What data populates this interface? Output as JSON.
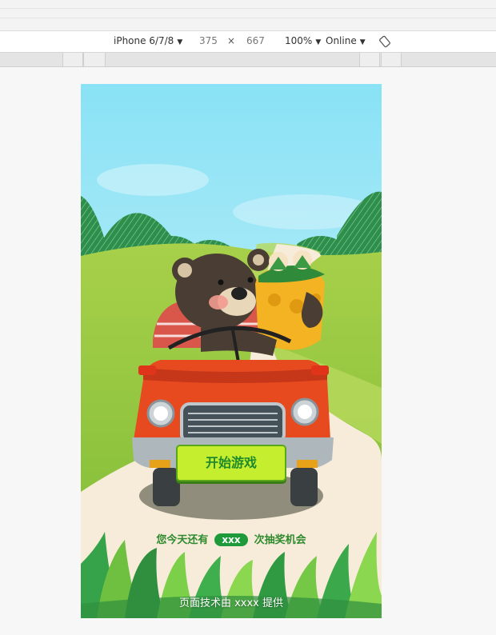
{
  "devtools": {
    "device_label": "iPhone 6/7/8",
    "width": "375",
    "times": "×",
    "height": "667",
    "zoom": "100%",
    "network": "Online",
    "rotate_icon": "rotate-icon"
  },
  "game": {
    "start_button": "开始游戏",
    "chances_prefix": "您今天还有",
    "chances_count": "xxx",
    "chances_suffix": "次抽奖机会",
    "footer": "页面技术由 xxxx 提供"
  },
  "colors": {
    "sky_top": "#89e2f5",
    "grass": "#8dc63f",
    "start_button_bg": "#c5ee2e",
    "start_button_text": "#1e8a2c",
    "badge_bg": "#1e9a3a",
    "car_body": "#e84a20"
  }
}
